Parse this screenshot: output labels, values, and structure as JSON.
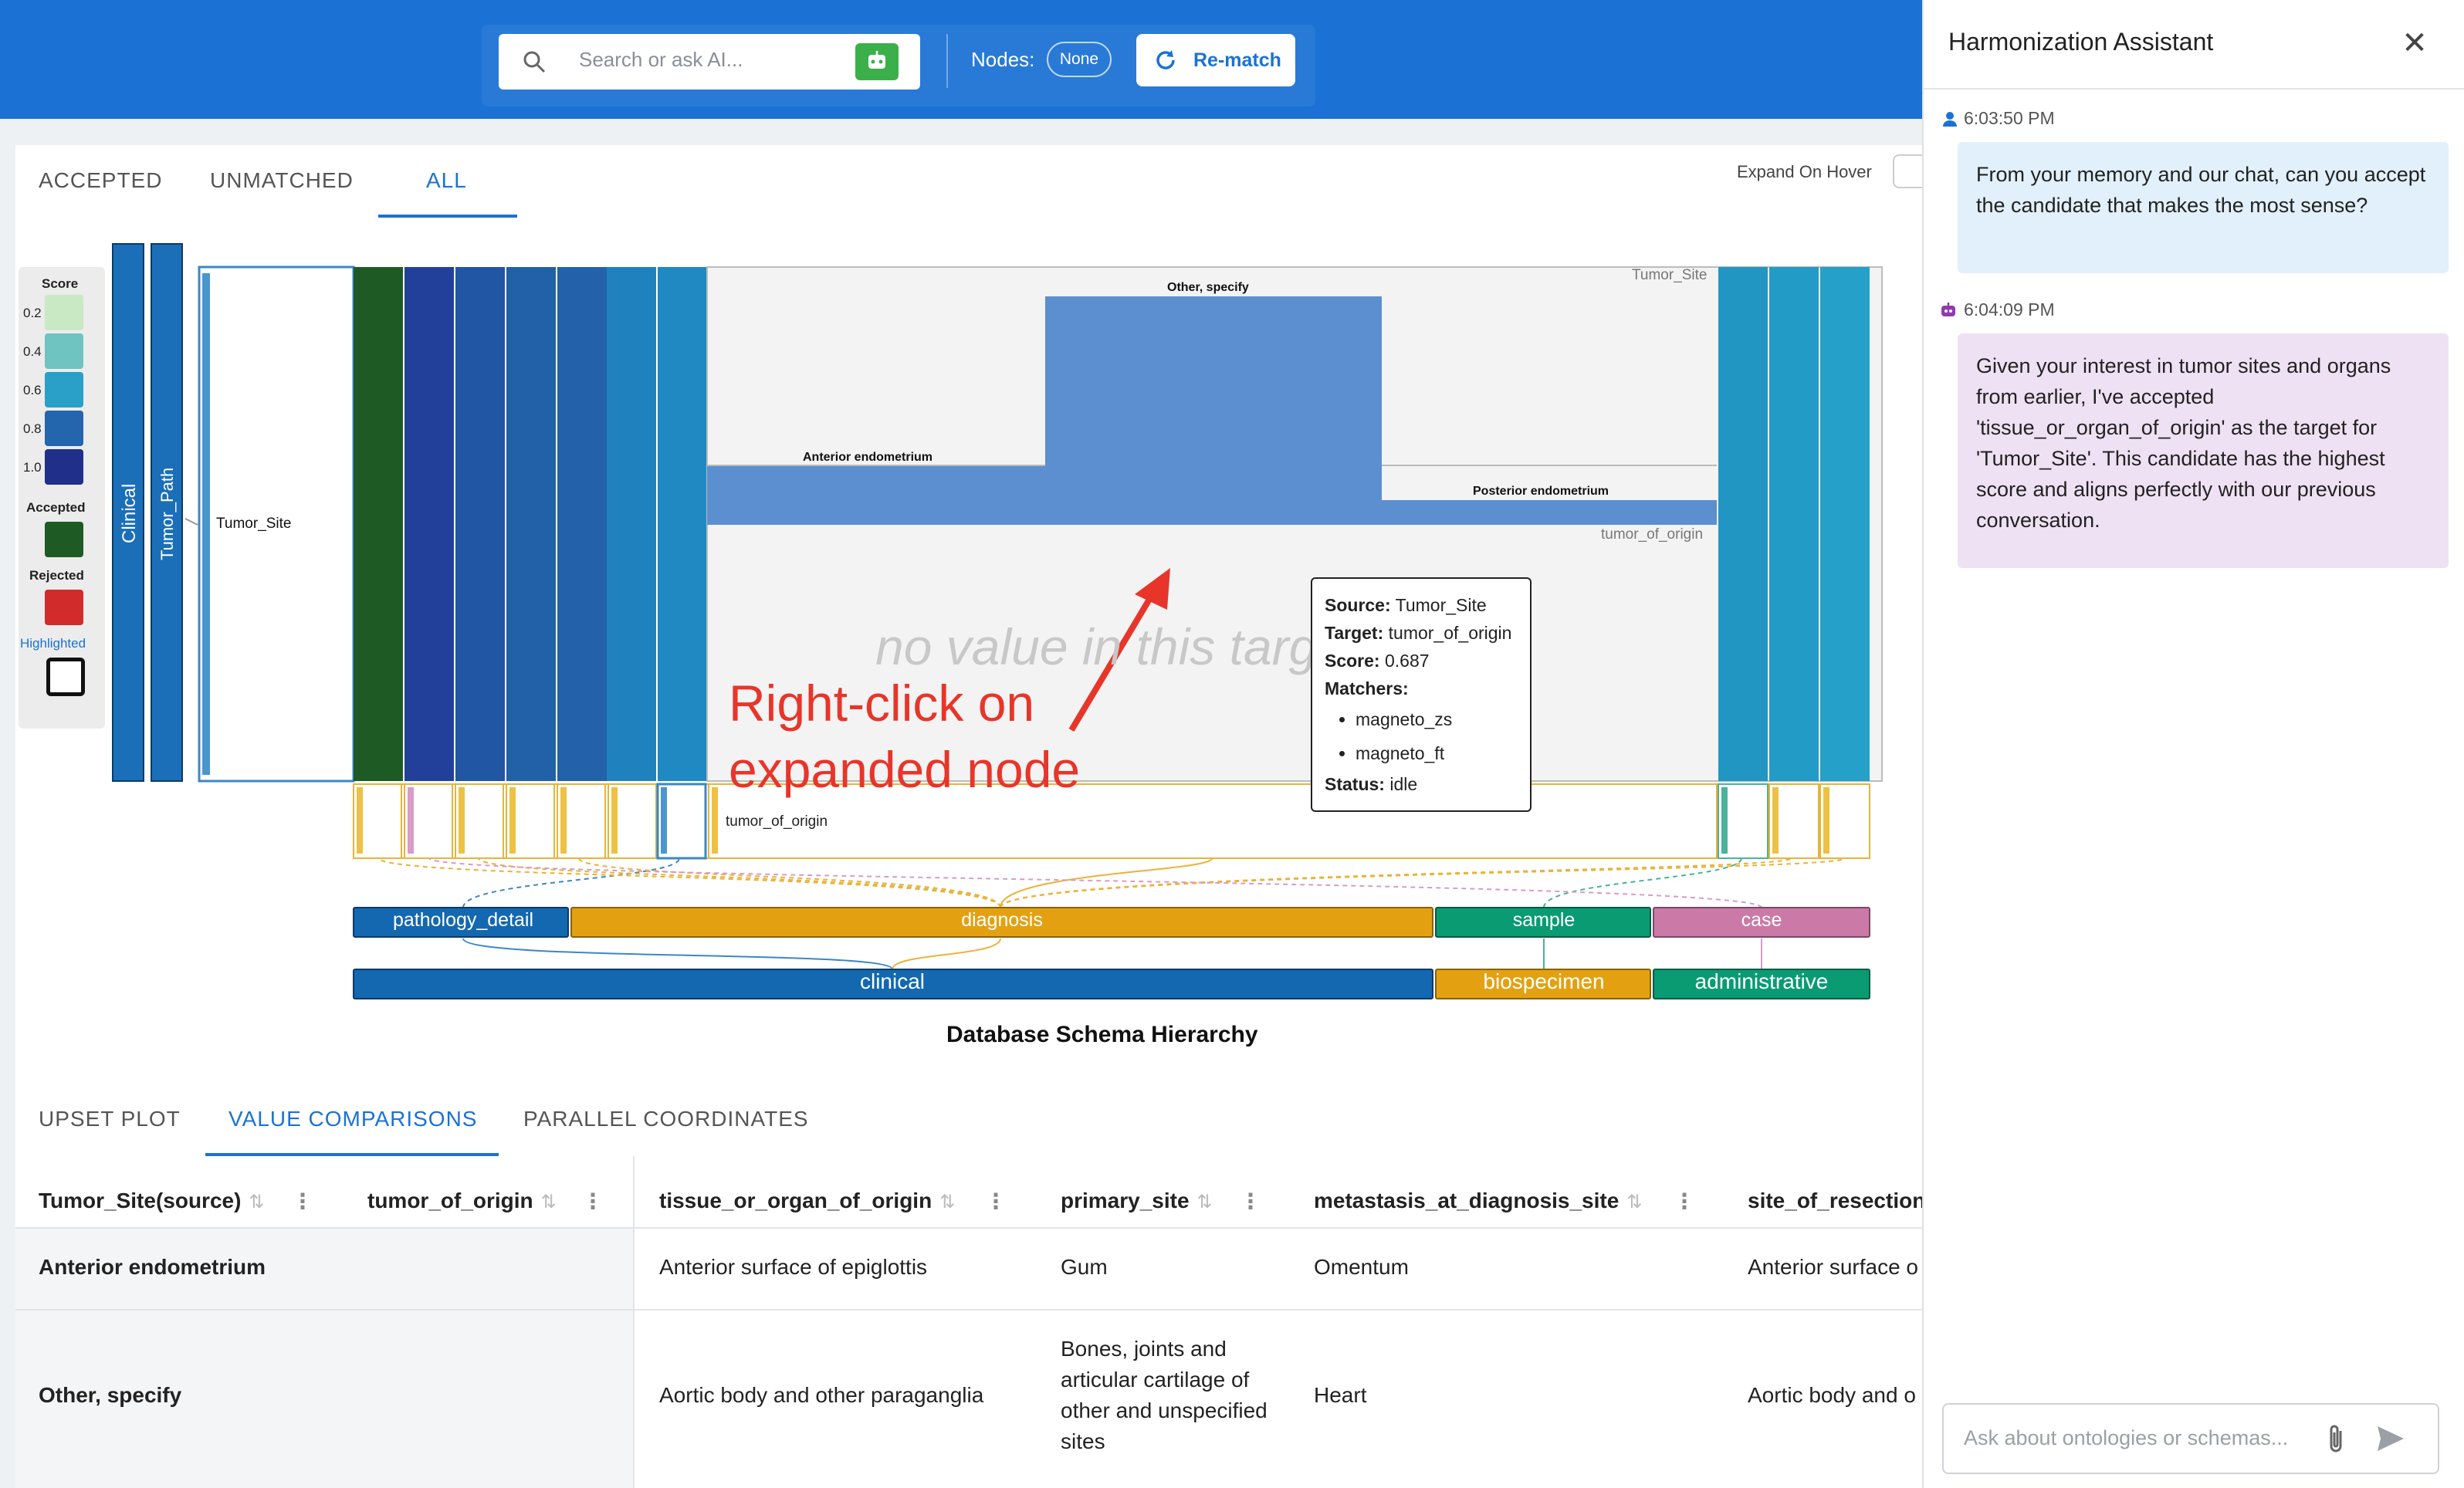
{
  "search": {
    "placeholder": "Search or ask AI..."
  },
  "toolbar": {
    "nodes_label": "Nodes:",
    "nodes_value": "None",
    "rematch_label": "Re-match"
  },
  "tabs": {
    "accepted": "ACCEPTED",
    "unmatched": "UNMATCHED",
    "all": "ALL"
  },
  "expand_on_hover": "Expand On Hover",
  "legend": {
    "title": "Score",
    "ticks": [
      "0.2",
      "0.4",
      "0.6",
      "0.8",
      "1.0"
    ],
    "accepted": "Accepted",
    "rejected": "Rejected",
    "highlighted": "Highlighted",
    "colors": {
      "accepted": "#1e5b24",
      "rejected": "#d22b2b",
      "highlighted": "#1b72d4"
    }
  },
  "source_nodes": {
    "clinical": "Clinical",
    "tumor_path": "Tumor_Path",
    "tumor_site": "Tumor_Site"
  },
  "expanded": {
    "source_label": "Tumor_Site",
    "target_label": "tumor_of_origin",
    "values": [
      "Anterior endometrium",
      "Other, specify",
      "Posterior endometrium"
    ]
  },
  "target_leaf_label": "tumor_of_origin",
  "ghost_text": "no value in this target",
  "annotation": "Right-click on\nexpanded node",
  "tooltip": {
    "source_label": "Source:",
    "source": "Tumor_Site",
    "target_label": "Target:",
    "target": "tumor_of_origin",
    "score_label": "Score:",
    "score": "0.687",
    "matchers_label": "Matchers:",
    "matchers": [
      "magneto_zs",
      "magneto_ft"
    ],
    "status_label": "Status:",
    "status": "idle"
  },
  "hierarchy": {
    "level1": [
      "pathology_detail",
      "diagnosis",
      "sample",
      "case"
    ],
    "level2": [
      "clinical",
      "biospecimen",
      "administrative"
    ],
    "title": "Database Schema Hierarchy"
  },
  "bottom_tabs": {
    "upset": "UPSET PLOT",
    "value": "VALUE COMPARISONS",
    "parallel": "PARALLEL COORDINATES"
  },
  "table": {
    "headers": [
      "Tumor_Site(source)",
      "tumor_of_origin",
      "tissue_or_organ_of_origin",
      "primary_site",
      "metastasis_at_diagnosis_site",
      "site_of_resection"
    ],
    "rows": [
      [
        "Anterior endometrium",
        "",
        "Anterior surface of epiglottis",
        "Gum",
        "Omentum",
        "Anterior surface o"
      ],
      [
        "Other, specify",
        "",
        "Aortic body and other paraganglia",
        "Bones, joints and articular cartilage of other and unspecified sites",
        "Heart",
        "Aortic body and o"
      ]
    ]
  },
  "assistant": {
    "title": "Harmonization Assistant",
    "messages": [
      {
        "role": "user",
        "time": "6:03:50 PM",
        "text": "From your memory and our chat, can you accept the candidate that makes the most sense?"
      },
      {
        "role": "assistant",
        "time": "6:04:09 PM",
        "text": "Given your interest in tumor sites and organs from earlier, I've accepted 'tissue_or_organ_of_origin' as the target for 'Tumor_Site'. This candidate has the highest score and aligns perfectly with our previous conversation."
      }
    ],
    "input_placeholder": "Ask about ontologies or schemas..."
  }
}
